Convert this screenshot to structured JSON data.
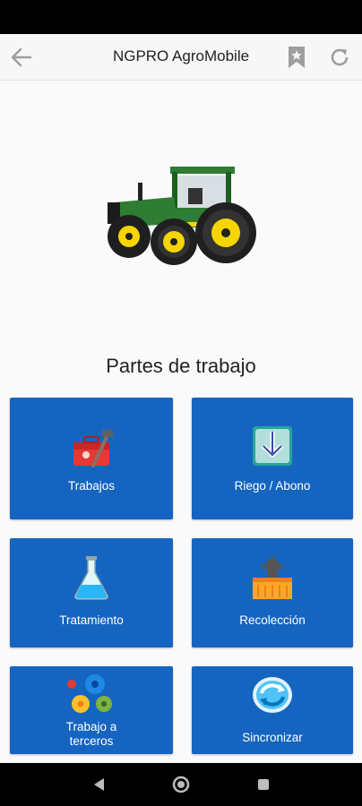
{
  "app_bar": {
    "title": "NGPRO AgroMobile"
  },
  "section_title": "Partes de trabajo",
  "tiles": [
    {
      "label": "Trabajos",
      "icon": "toolbox-icon"
    },
    {
      "label": "Riego / Abono",
      "icon": "download-arrow-icon"
    },
    {
      "label": "Tratamiento",
      "icon": "flask-icon"
    },
    {
      "label": "Recolección",
      "icon": "crate-upload-icon"
    },
    {
      "label": "Trabajo a\nterceros",
      "icon": "gears-icon"
    },
    {
      "label": "Sincronizar",
      "icon": "sync-icon"
    }
  ],
  "colors": {
    "tile": "#1565c0",
    "app_bar": "#f7f7f7",
    "tractor_green": "#2e7d32",
    "tractor_yellow": "#f6d500"
  }
}
